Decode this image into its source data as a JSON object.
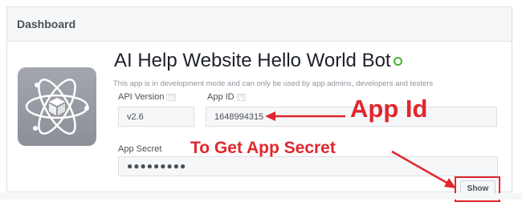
{
  "header": {
    "title": "Dashboard"
  },
  "app": {
    "name": "AI Help Website Hello World Bot",
    "dev_note": "This app is in development mode and can only be used by app admins, developers and testers",
    "icon": "atom-cube-icon"
  },
  "fields": {
    "api_version": {
      "label": "API Version",
      "help": "[?]",
      "value": "v2.6"
    },
    "app_id": {
      "label": "App ID",
      "help": "[?]",
      "value": "1648994315"
    },
    "app_secret": {
      "label": "App Secret",
      "value": "●●●●●●●●●",
      "button": "Show"
    }
  },
  "annotations": {
    "app_id": "App Id",
    "app_secret": "To Get App Secret"
  },
  "colors": {
    "annotation": "#e0272d",
    "status": "#42b72a",
    "header_bg": "#f6f7f9"
  }
}
